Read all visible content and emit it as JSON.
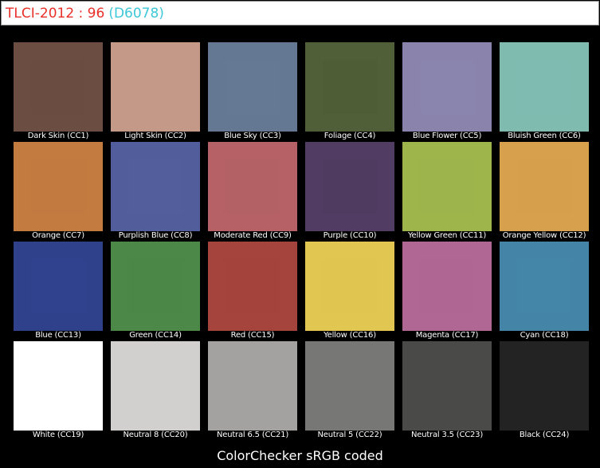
{
  "header": {
    "score_text": "TLCI-2012 : 96",
    "illuminant_text": "(D6078)",
    "score_color": "#e8302a",
    "illuminant_color": "#3ec8d8"
  },
  "footer": {
    "caption": "ColorChecker sRGB coded"
  },
  "patches": [
    {
      "label": "Dark Skin (CC1)",
      "color": "#6b4e41",
      "inner": "#6a4d40"
    },
    {
      "label": "Light Skin (CC2)",
      "color": "#c59988",
      "inner": "#c49987"
    },
    {
      "label": "Blue Sky (CC3)",
      "color": "#647893",
      "inner": "#657994"
    },
    {
      "label": "Foliage (CC4)",
      "color": "#515f38",
      "inner": "#4f5d37"
    },
    {
      "label": "Blue Flower (CC5)",
      "color": "#8a84ad",
      "inner": "#8985ae"
    },
    {
      "label": "Bluish Green (CC6)",
      "color": "#80bbaf",
      "inner": "#7fbbaf"
    },
    {
      "label": "Orange (CC7)",
      "color": "#c47b40",
      "inner": "#c37a40"
    },
    {
      "label": "Purplish Blue (CC8)",
      "color": "#525e9b",
      "inner": "#535f9c"
    },
    {
      "label": "Moderate Red (CC9)",
      "color": "#b56166",
      "inner": "#b46166"
    },
    {
      "label": "Purple (CC10)",
      "color": "#513c63",
      "inner": "#4f3a60"
    },
    {
      "label": "Yellow Green (CC11)",
      "color": "#9eb54c",
      "inner": "#9db44c"
    },
    {
      "label": "Orange Yellow (CC12)",
      "color": "#d6a04c",
      "inner": "#d59f4b"
    },
    {
      "label": "Blue (CC13)",
      "color": "#30418c",
      "inner": "#31428e"
    },
    {
      "label": "Green (CC14)",
      "color": "#4c8848",
      "inner": "#4b8747"
    },
    {
      "label": "Red (CC15)",
      "color": "#a4443d",
      "inner": "#a3433c"
    },
    {
      "label": "Yellow (CC16)",
      "color": "#e1c652",
      "inner": "#e0c551"
    },
    {
      "label": "Magenta (CC17)",
      "color": "#b06793",
      "inner": "#af6692"
    },
    {
      "label": "Cyan (CC18)",
      "color": "#4485a7",
      "inner": "#4486a8"
    },
    {
      "label": "White (CC19)",
      "color": "#ffffff",
      "inner": "#ffffff"
    },
    {
      "label": "Neutral 8 (CC20)",
      "color": "#d1d0ce",
      "inner": "#d1d0ce"
    },
    {
      "label": "Neutral 6.5 (CC21)",
      "color": "#a3a2a0",
      "inner": "#a3a2a0"
    },
    {
      "label": "Neutral 5 (CC22)",
      "color": "#777775",
      "inner": "#777775"
    },
    {
      "label": "Neutral 3.5 (CC23)",
      "color": "#4a4a49",
      "inner": "#4a4a49"
    },
    {
      "label": "Black (CC24)",
      "color": "#232323",
      "inner": "#232323"
    }
  ]
}
